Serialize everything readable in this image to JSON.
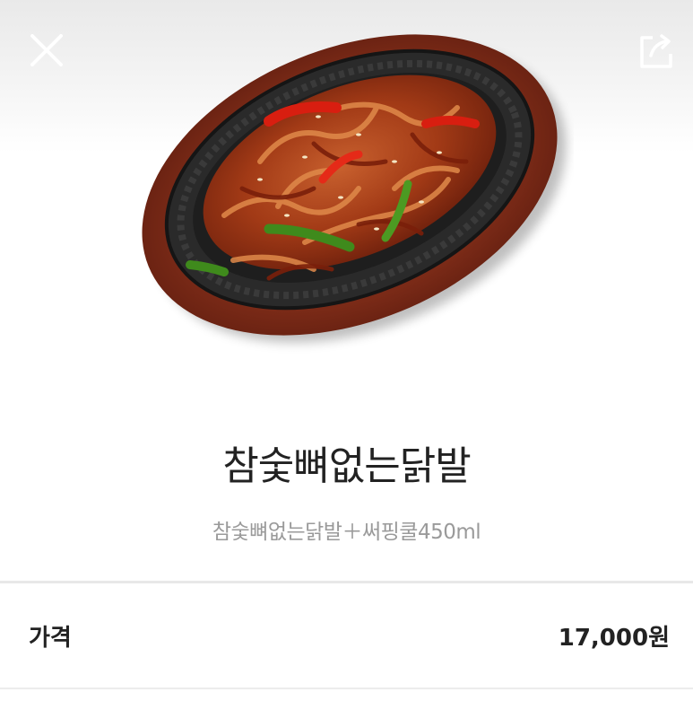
{
  "header": {
    "close_icon": "close-icon",
    "share_icon": "share-icon"
  },
  "product": {
    "name": "참숯뼈없는닭발",
    "description": "참숯뼈없는닭발＋써핑쿨450ml"
  },
  "price": {
    "label": "가격",
    "value": "17,000원"
  },
  "colors": {
    "title": "#222222",
    "subtitle": "#9a9a9a",
    "divider": "#e8e8e8",
    "plate_wood": "#7a2a17",
    "plate_iron": "#242424"
  }
}
